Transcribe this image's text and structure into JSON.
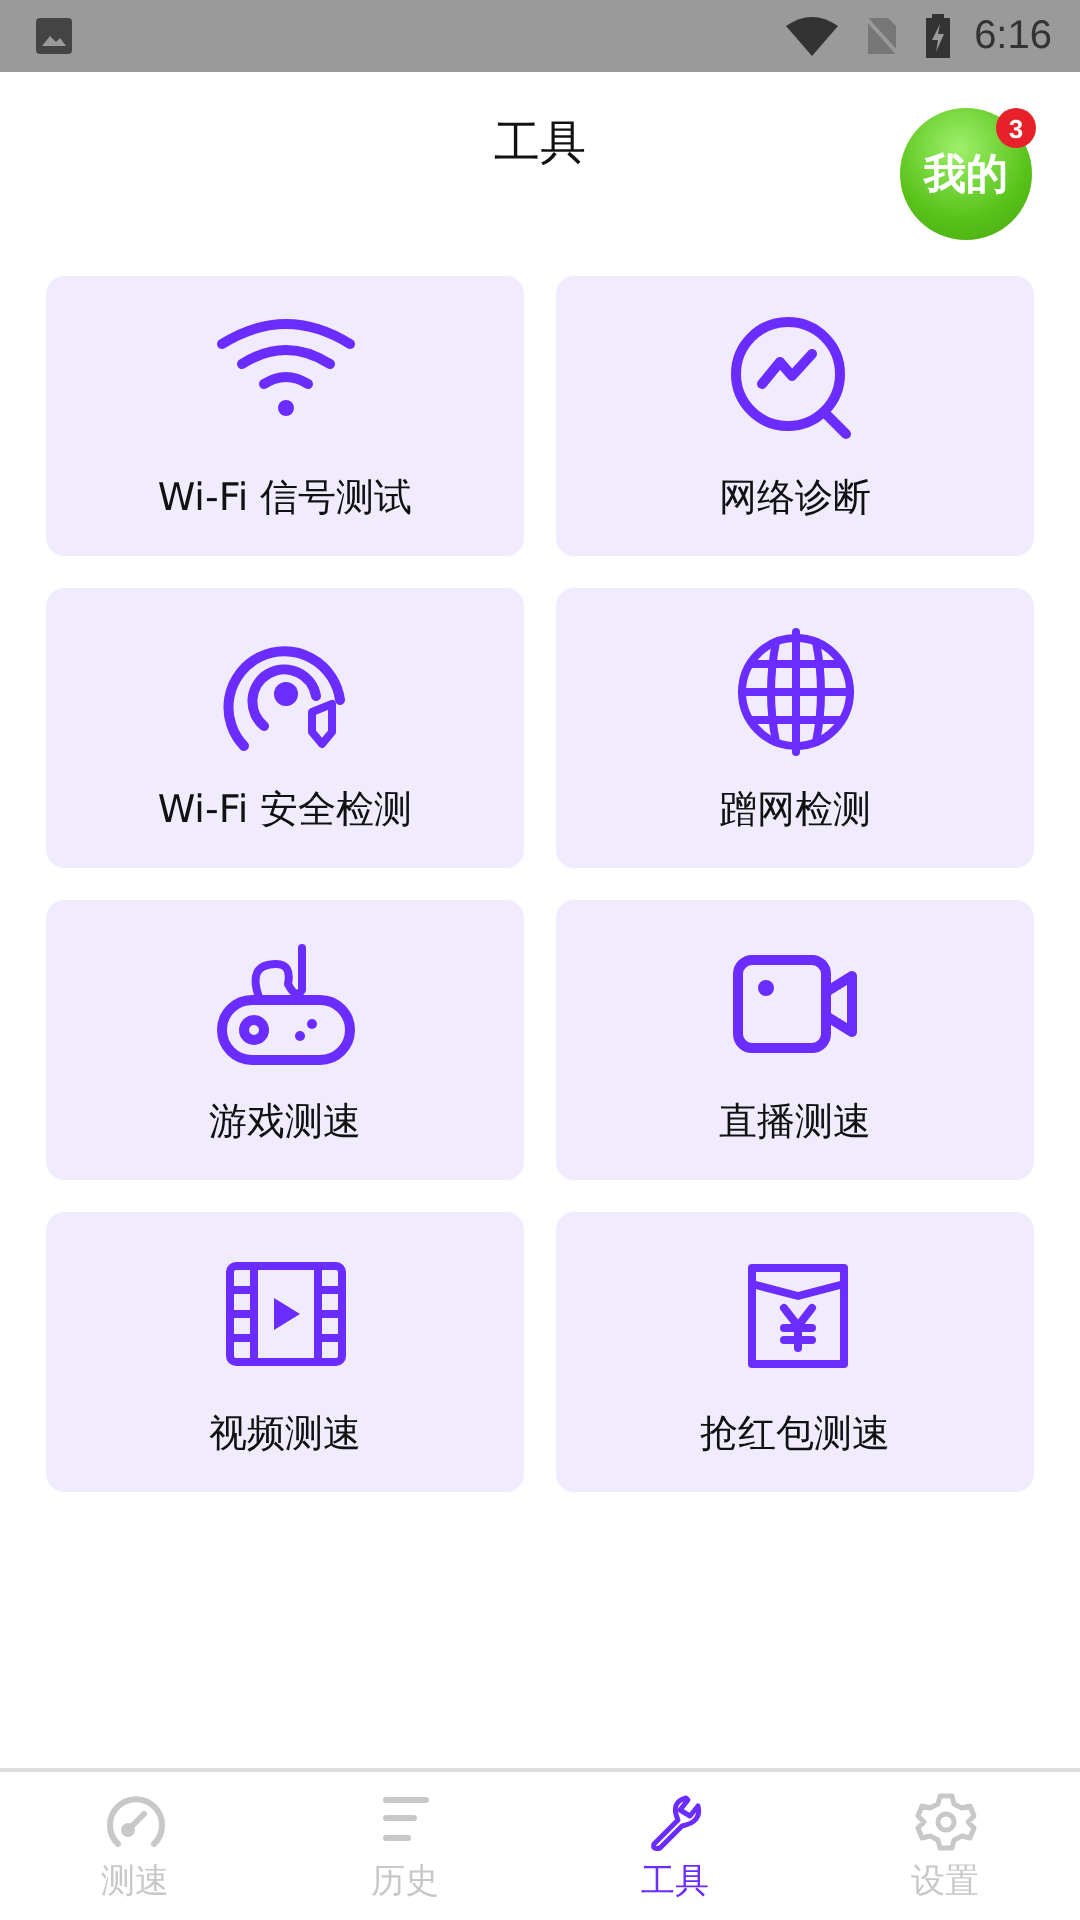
{
  "status_bar": {
    "time": "6:16"
  },
  "header": {
    "title": "工具",
    "profile_button": {
      "label": "我的",
      "badge": "3"
    }
  },
  "tools": [
    {
      "label": "Wi-Fi 信号测试"
    },
    {
      "label": "网络诊断"
    },
    {
      "label": "Wi-Fi 安全检测"
    },
    {
      "label": "蹭网检测"
    },
    {
      "label": "游戏测速"
    },
    {
      "label": "直播测速"
    },
    {
      "label": "视频测速"
    },
    {
      "label": "抢红包测速"
    }
  ],
  "tabs": [
    {
      "label": "测速",
      "selected": false
    },
    {
      "label": "历史",
      "selected": false
    },
    {
      "label": "工具",
      "selected": true
    },
    {
      "label": "设置",
      "selected": false
    }
  ]
}
